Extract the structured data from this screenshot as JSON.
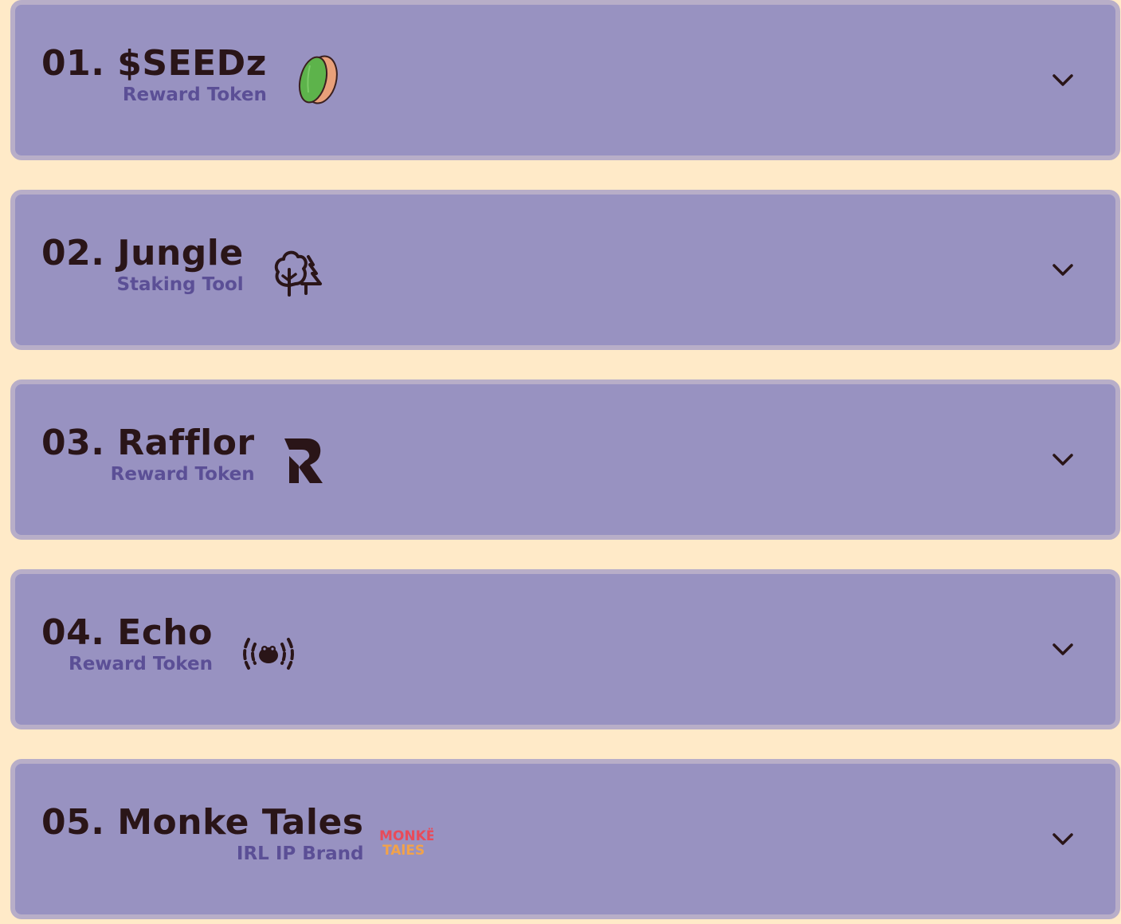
{
  "items": [
    {
      "title": "01. $SEEDz",
      "subtitle": "Reward Token",
      "icon": "seed-icon"
    },
    {
      "title": "02. Jungle",
      "subtitle": "Staking Tool",
      "icon": "trees-icon"
    },
    {
      "title": "03. Rafflor",
      "subtitle": "Reward Token",
      "icon": "rafflor-logo-icon"
    },
    {
      "title": "04. Echo",
      "subtitle": "Reward Token",
      "icon": "echo-broadcast-icon"
    },
    {
      "title": "05. Monke Tales",
      "subtitle": "IRL IP Brand",
      "icon": "monke-tales-logo",
      "logo_text": [
        "MONKË",
        "TAlES"
      ]
    }
  ],
  "colors": {
    "background": "#FFEAC8",
    "card": "#9892C1",
    "card_border": "#B8AEC8",
    "title": "#2A1518",
    "subtitle": "#5B4F96"
  }
}
